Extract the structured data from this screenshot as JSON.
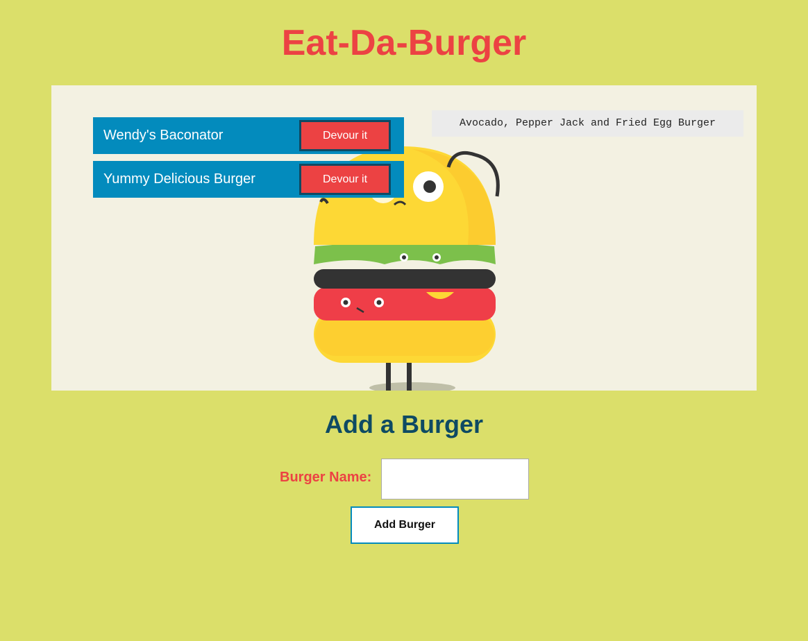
{
  "app": {
    "title": "Eat-Da-Burger"
  },
  "burgers": [
    {
      "name": "Wendy's Baconator",
      "action_label": "Devour it"
    },
    {
      "name": "Yummy Delicious Burger",
      "action_label": "Devour it"
    }
  ],
  "devoured": [
    {
      "name": "Avocado, Pepper Jack and Fried Egg Burger"
    }
  ],
  "add_form": {
    "heading": "Add a Burger",
    "label": "Burger Name:",
    "input_value": "",
    "submit_label": "Add Burger"
  },
  "colors": {
    "page_bg": "#dbdf6a",
    "title": "#ec4243",
    "row_bg": "#038bbd",
    "button_bg": "#ec4243",
    "heading": "#0e4a63"
  }
}
